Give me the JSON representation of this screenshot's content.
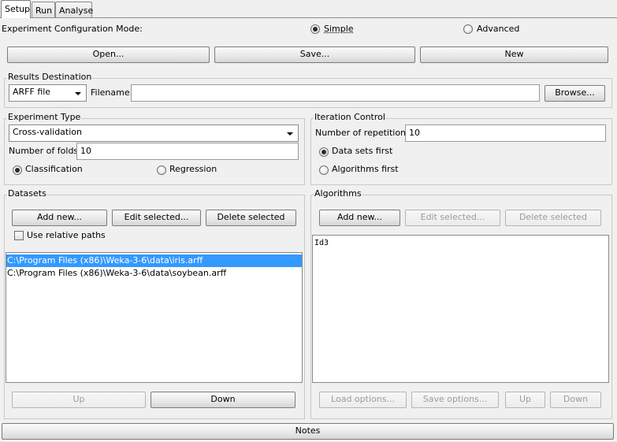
{
  "tabs": [
    {
      "label": "Setup",
      "active": true
    },
    {
      "label": "Run",
      "active": false
    },
    {
      "label": "Analyse",
      "active": false
    }
  ],
  "config_mode": {
    "label": "Experiment Configuration Mode:",
    "simple": "Simple",
    "advanced": "Advanced",
    "selected": "Simple"
  },
  "file_buttons": {
    "open": "Open...",
    "save": "Save...",
    "new": "New"
  },
  "results_destination": {
    "title": "Results Destination",
    "type_value": "ARFF file",
    "filename_label": "Filename:",
    "filename_value": "",
    "browse": "Browse..."
  },
  "experiment_type": {
    "title": "Experiment Type",
    "type_value": "Cross-validation",
    "folds_label": "Number of folds:",
    "folds_value": "10",
    "classification": "Classification",
    "regression": "Regression",
    "selected": "Classification"
  },
  "iteration_control": {
    "title": "Iteration Control",
    "repetitions_label": "Number of repetitions:",
    "repetitions_value": "10",
    "data_sets_first": "Data sets first",
    "algorithms_first": "Algorithms first",
    "selected": "Data sets first"
  },
  "datasets": {
    "title": "Datasets",
    "add_new": "Add new...",
    "edit_selected": "Edit selected...",
    "delete_selected": "Delete selected",
    "use_relative_paths": "Use relative paths",
    "items": [
      "C:\\Program Files (x86)\\Weka-3-6\\data\\iris.arff",
      "C:\\Program Files (x86)\\Weka-3-6\\data\\soybean.arff"
    ],
    "selected_index": 0,
    "up": "Up",
    "down": "Down"
  },
  "algorithms": {
    "title": "Algorithms",
    "add_new": "Add new...",
    "edit_selected": "Edit selected...",
    "delete_selected": "Delete selected",
    "items": [
      "Id3"
    ],
    "load_options": "Load options...",
    "save_options": "Save options...",
    "up": "Up",
    "down": "Down"
  },
  "notes": "Notes"
}
